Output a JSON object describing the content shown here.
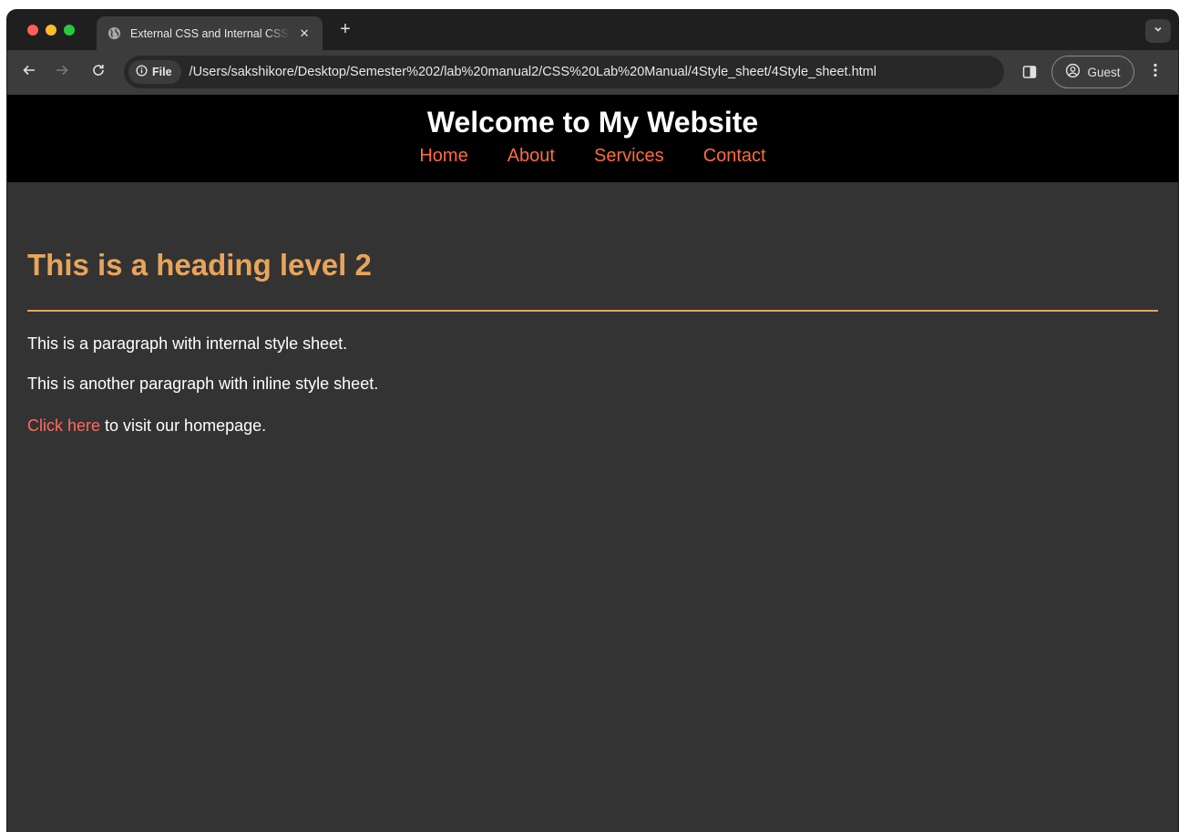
{
  "browser": {
    "tab_title": "External CSS and Internal CSS",
    "tab_close": "✕",
    "new_tab": "+",
    "site_chip_label": "File",
    "url": "/Users/sakshikore/Desktop/Semester%202/lab%20manual2/CSS%20Lab%20Manual/4Style_sheet/4Style_sheet.html",
    "profile_label": "Guest"
  },
  "page": {
    "site_title": "Welcome to My Website",
    "nav": [
      {
        "label": "Home"
      },
      {
        "label": "About"
      },
      {
        "label": "Services"
      },
      {
        "label": "Contact"
      }
    ],
    "heading": "This is a heading level 2",
    "paragraph_1": "This is a paragraph with internal style sheet.",
    "paragraph_2": "This is another paragraph with inline style sheet.",
    "link_text": "Click here",
    "link_suffix": " to visit our homepage."
  },
  "colors": {
    "header_bg": "#000000",
    "nav_link": "#ff6b3d",
    "heading": "#e9a45a",
    "link": "#ff6b5b",
    "page_bg": "#333333"
  }
}
